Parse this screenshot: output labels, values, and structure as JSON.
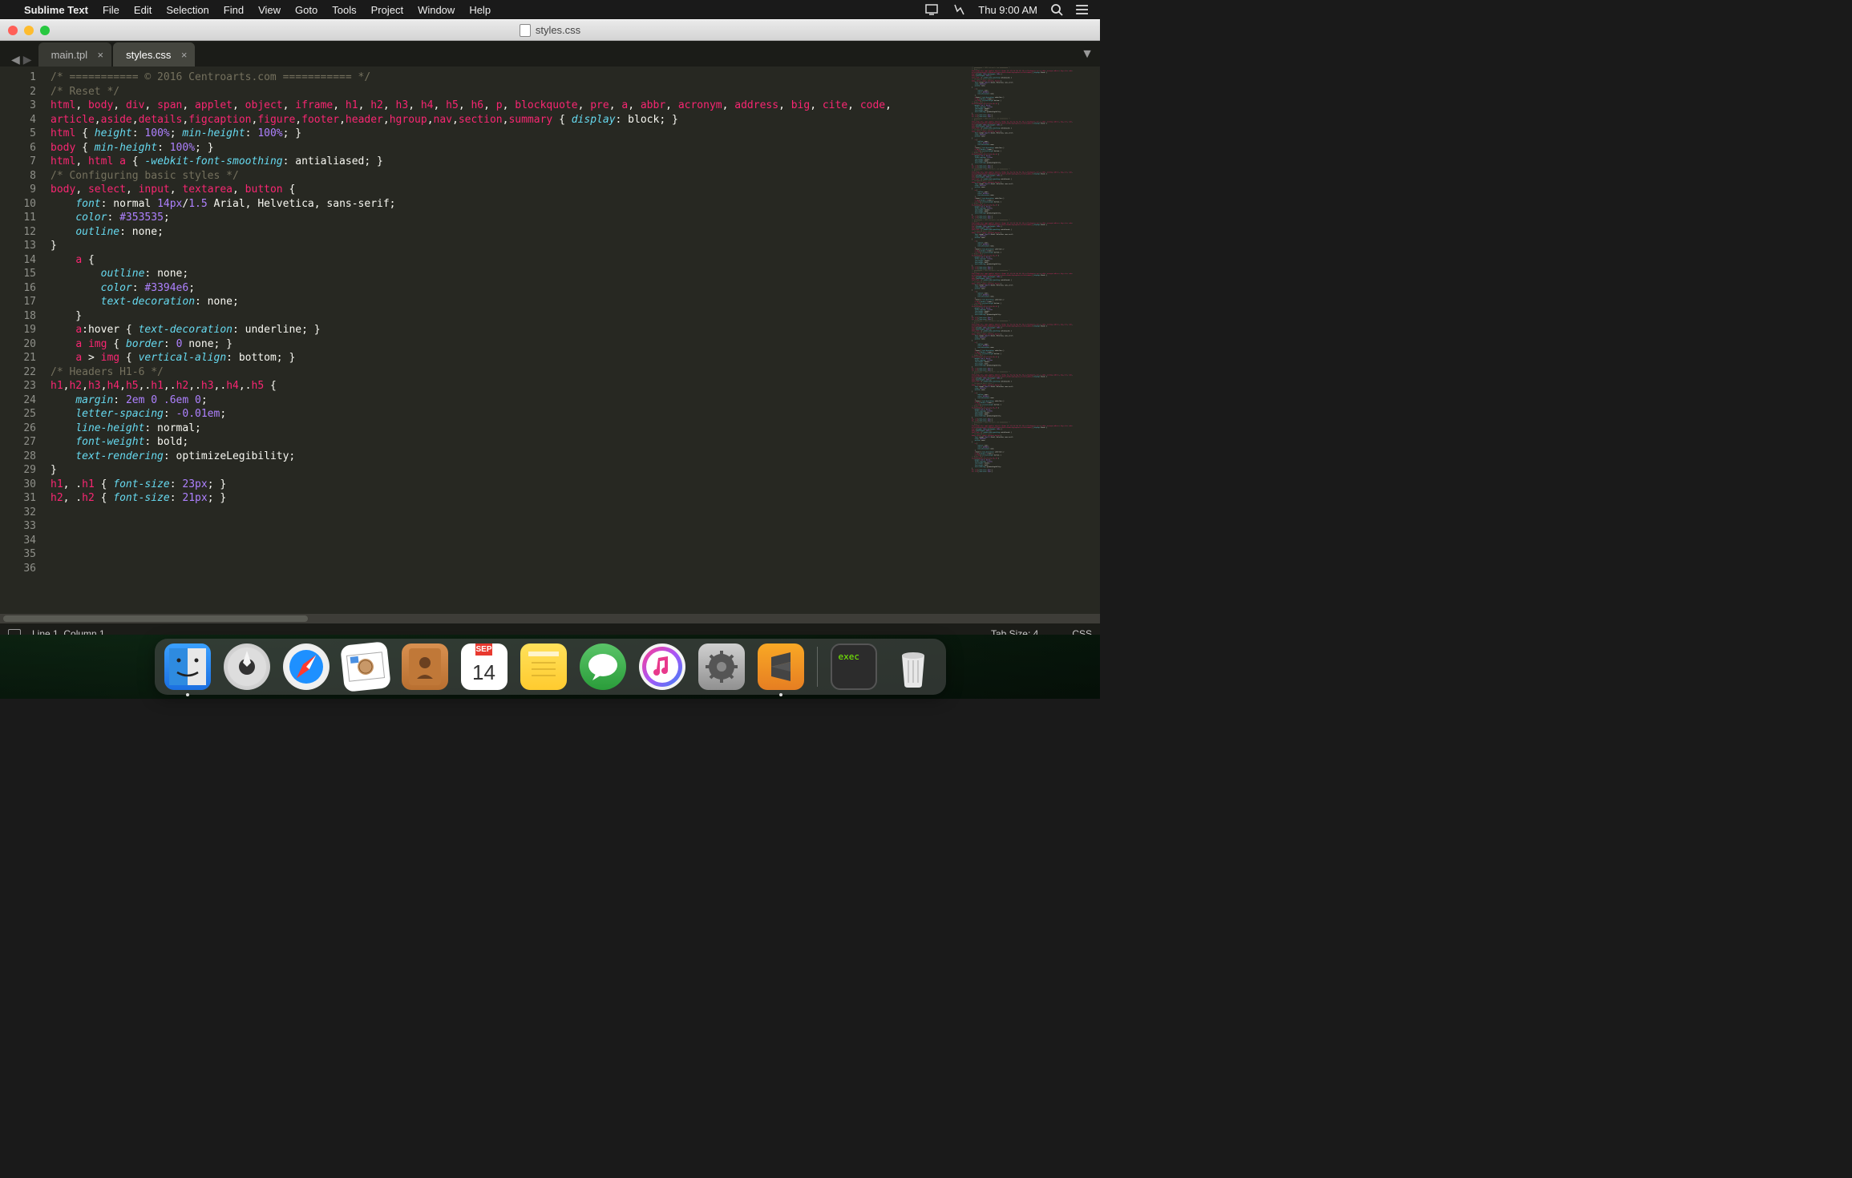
{
  "menubar": {
    "app": "Sublime Text",
    "items": [
      "File",
      "Edit",
      "Selection",
      "Find",
      "View",
      "Goto",
      "Tools",
      "Project",
      "Window",
      "Help"
    ],
    "clock": "Thu 9:00 AM"
  },
  "window": {
    "title": "styles.css"
  },
  "tabs": [
    {
      "label": "main.tpl",
      "active": false
    },
    {
      "label": "styles.css",
      "active": true
    }
  ],
  "status": {
    "position": "Line 1, Column 1",
    "tabsize": "Tab Size: 4",
    "syntax": "CSS"
  },
  "calendar": {
    "month": "SEP",
    "day": "14"
  },
  "code_lines": [
    [
      [
        "c-comment",
        "/* =========== © 2016 Centroarts.com =========== */"
      ]
    ],
    [
      [
        "",
        ""
      ]
    ],
    [
      [
        "c-comment",
        "/* Reset */"
      ]
    ],
    [
      [
        "c-tag",
        "html"
      ],
      [
        "c-punc",
        ", "
      ],
      [
        "c-tag",
        "body"
      ],
      [
        "c-punc",
        ", "
      ],
      [
        "c-tag",
        "div"
      ],
      [
        "c-punc",
        ", "
      ],
      [
        "c-tag",
        "span"
      ],
      [
        "c-punc",
        ", "
      ],
      [
        "c-tag",
        "applet"
      ],
      [
        "c-punc",
        ", "
      ],
      [
        "c-tag",
        "object"
      ],
      [
        "c-punc",
        ", "
      ],
      [
        "c-tag",
        "iframe"
      ],
      [
        "c-punc",
        ", "
      ],
      [
        "c-tag",
        "h1"
      ],
      [
        "c-punc",
        ", "
      ],
      [
        "c-tag",
        "h2"
      ],
      [
        "c-punc",
        ", "
      ],
      [
        "c-tag",
        "h3"
      ],
      [
        "c-punc",
        ", "
      ],
      [
        "c-tag",
        "h4"
      ],
      [
        "c-punc",
        ", "
      ],
      [
        "c-tag",
        "h5"
      ],
      [
        "c-punc",
        ", "
      ],
      [
        "c-tag",
        "h6"
      ],
      [
        "c-punc",
        ", "
      ],
      [
        "c-tag",
        "p"
      ],
      [
        "c-punc",
        ", "
      ],
      [
        "c-tag",
        "blockquote"
      ],
      [
        "c-punc",
        ", "
      ],
      [
        "c-tag",
        "pre"
      ],
      [
        "c-punc",
        ", "
      ],
      [
        "c-tag",
        "a"
      ],
      [
        "c-punc",
        ", "
      ],
      [
        "c-tag",
        "abbr"
      ],
      [
        "c-punc",
        ", "
      ],
      [
        "c-tag",
        "acronym"
      ],
      [
        "c-punc",
        ", "
      ],
      [
        "c-tag",
        "address"
      ],
      [
        "c-punc",
        ", "
      ],
      [
        "c-tag",
        "big"
      ],
      [
        "c-punc",
        ", "
      ],
      [
        "c-tag",
        "cite"
      ],
      [
        "c-punc",
        ", "
      ],
      [
        "c-tag",
        "code"
      ],
      [
        "c-punc",
        ", "
      ]
    ],
    [
      [
        "c-tag",
        "article"
      ],
      [
        "c-punc",
        ","
      ],
      [
        "c-tag",
        "aside"
      ],
      [
        "c-punc",
        ","
      ],
      [
        "c-tag",
        "details"
      ],
      [
        "c-punc",
        ","
      ],
      [
        "c-tag",
        "figcaption"
      ],
      [
        "c-punc",
        ","
      ],
      [
        "c-tag",
        "figure"
      ],
      [
        "c-punc",
        ","
      ],
      [
        "c-tag",
        "footer"
      ],
      [
        "c-punc",
        ","
      ],
      [
        "c-tag",
        "header"
      ],
      [
        "c-punc",
        ","
      ],
      [
        "c-tag",
        "hgroup"
      ],
      [
        "c-punc",
        ","
      ],
      [
        "c-tag",
        "nav"
      ],
      [
        "c-punc",
        ","
      ],
      [
        "c-tag",
        "section"
      ],
      [
        "c-punc",
        ","
      ],
      [
        "c-tag",
        "summary"
      ],
      [
        "c-white",
        " { "
      ],
      [
        "c-prop",
        "display"
      ],
      [
        "c-white",
        ": block; }"
      ]
    ],
    [
      [
        "",
        ""
      ]
    ],
    [
      [
        "c-tag",
        "html"
      ],
      [
        "c-white",
        " { "
      ],
      [
        "c-prop",
        "height"
      ],
      [
        "c-white",
        ": "
      ],
      [
        "c-num",
        "100%"
      ],
      [
        "c-white",
        "; "
      ],
      [
        "c-prop",
        "min-height"
      ],
      [
        "c-white",
        ": "
      ],
      [
        "c-num",
        "100%"
      ],
      [
        "c-white",
        "; }"
      ]
    ],
    [
      [
        "c-tag",
        "body"
      ],
      [
        "c-white",
        " { "
      ],
      [
        "c-prop",
        "min-height"
      ],
      [
        "c-white",
        ": "
      ],
      [
        "c-num",
        "100%"
      ],
      [
        "c-white",
        "; }"
      ]
    ],
    [
      [
        "c-tag",
        "html"
      ],
      [
        "c-punc",
        ", "
      ],
      [
        "c-tag",
        "html"
      ],
      [
        "c-white",
        " "
      ],
      [
        "c-tag",
        "a"
      ],
      [
        "c-white",
        " { "
      ],
      [
        "c-prop",
        "-webkit-font-smoothing"
      ],
      [
        "c-white",
        ": antialiased; }"
      ]
    ],
    [
      [
        "",
        ""
      ]
    ],
    [
      [
        "c-comment",
        "/* Configuring basic styles */"
      ]
    ],
    [
      [
        "c-tag",
        "body"
      ],
      [
        "c-punc",
        ", "
      ],
      [
        "c-tag",
        "select"
      ],
      [
        "c-punc",
        ", "
      ],
      [
        "c-tag",
        "input"
      ],
      [
        "c-punc",
        ", "
      ],
      [
        "c-tag",
        "textarea"
      ],
      [
        "c-punc",
        ", "
      ],
      [
        "c-tag",
        "button"
      ],
      [
        "c-white",
        " {"
      ]
    ],
    [
      [
        "c-white",
        "    "
      ],
      [
        "c-prop",
        "font"
      ],
      [
        "c-white",
        ": normal "
      ],
      [
        "c-num",
        "14px"
      ],
      [
        "c-white",
        "/"
      ],
      [
        "c-num",
        "1.5"
      ],
      [
        "c-white",
        " Arial, Helvetica, sans-serif;"
      ]
    ],
    [
      [
        "c-white",
        "    "
      ],
      [
        "c-prop",
        "color"
      ],
      [
        "c-white",
        ": "
      ],
      [
        "c-num",
        "#353535"
      ],
      [
        "c-white",
        ";"
      ]
    ],
    [
      [
        "c-white",
        "    "
      ],
      [
        "c-prop",
        "outline"
      ],
      [
        "c-white",
        ": none;"
      ]
    ],
    [
      [
        "c-white",
        "}"
      ]
    ],
    [
      [
        "c-white",
        "    "
      ],
      [
        "c-tag",
        "a"
      ],
      [
        "c-white",
        " {"
      ]
    ],
    [
      [
        "c-white",
        "        "
      ],
      [
        "c-prop",
        "outline"
      ],
      [
        "c-white",
        ": none;"
      ]
    ],
    [
      [
        "c-white",
        "        "
      ],
      [
        "c-prop",
        "color"
      ],
      [
        "c-white",
        ": "
      ],
      [
        "c-num",
        "#3394e6"
      ],
      [
        "c-white",
        ";"
      ]
    ],
    [
      [
        "c-white",
        "        "
      ],
      [
        "c-prop",
        "text-decoration"
      ],
      [
        "c-white",
        ": none;"
      ]
    ],
    [
      [
        "c-white",
        "    }"
      ]
    ],
    [
      [
        "c-white",
        "    "
      ],
      [
        "c-tag",
        "a"
      ],
      [
        "c-white",
        ":hover { "
      ],
      [
        "c-prop",
        "text-decoration"
      ],
      [
        "c-white",
        ": underline; }"
      ]
    ],
    [
      [
        "",
        ""
      ]
    ],
    [
      [
        "c-white",
        "    "
      ],
      [
        "c-tag",
        "a"
      ],
      [
        "c-white",
        " "
      ],
      [
        "c-tag",
        "img"
      ],
      [
        "c-white",
        " { "
      ],
      [
        "c-prop",
        "border"
      ],
      [
        "c-white",
        ": "
      ],
      [
        "c-num",
        "0"
      ],
      [
        "c-white",
        " none; }"
      ]
    ],
    [
      [
        "c-white",
        "    "
      ],
      [
        "c-tag",
        "a"
      ],
      [
        "c-white",
        " > "
      ],
      [
        "c-tag",
        "img"
      ],
      [
        "c-white",
        " { "
      ],
      [
        "c-prop",
        "vertical-align"
      ],
      [
        "c-white",
        ": bottom; }"
      ]
    ],
    [
      [
        "",
        ""
      ]
    ],
    [
      [
        "c-comment",
        "/* Headers H1-6 */"
      ]
    ],
    [
      [
        "c-tag",
        "h1"
      ],
      [
        "c-punc",
        ","
      ],
      [
        "c-tag",
        "h2"
      ],
      [
        "c-punc",
        ","
      ],
      [
        "c-tag",
        "h3"
      ],
      [
        "c-punc",
        ","
      ],
      [
        "c-tag",
        "h4"
      ],
      [
        "c-punc",
        ","
      ],
      [
        "c-tag",
        "h5"
      ],
      [
        "c-punc",
        ",."
      ],
      [
        "c-tag",
        "h1"
      ],
      [
        "c-punc",
        ",."
      ],
      [
        "c-tag",
        "h2"
      ],
      [
        "c-punc",
        ",."
      ],
      [
        "c-tag",
        "h3"
      ],
      [
        "c-punc",
        ",."
      ],
      [
        "c-tag",
        "h4"
      ],
      [
        "c-punc",
        ",."
      ],
      [
        "c-tag",
        "h5"
      ],
      [
        "c-white",
        " {"
      ]
    ],
    [
      [
        "c-white",
        "    "
      ],
      [
        "c-prop",
        "margin"
      ],
      [
        "c-white",
        ": "
      ],
      [
        "c-num",
        "2em"
      ],
      [
        "c-white",
        " "
      ],
      [
        "c-num",
        "0"
      ],
      [
        "c-white",
        " "
      ],
      [
        "c-num",
        ".6em"
      ],
      [
        "c-white",
        " "
      ],
      [
        "c-num",
        "0"
      ],
      [
        "c-white",
        ";"
      ]
    ],
    [
      [
        "c-white",
        "    "
      ],
      [
        "c-prop",
        "letter-spacing"
      ],
      [
        "c-white",
        ": "
      ],
      [
        "c-num",
        "-0.01em"
      ],
      [
        "c-white",
        ";"
      ]
    ],
    [
      [
        "c-white",
        "    "
      ],
      [
        "c-prop",
        "line-height"
      ],
      [
        "c-white",
        ": normal;"
      ]
    ],
    [
      [
        "c-white",
        "    "
      ],
      [
        "c-prop",
        "font-weight"
      ],
      [
        "c-white",
        ": bold;"
      ]
    ],
    [
      [
        "c-white",
        "    "
      ],
      [
        "c-prop",
        "text-rendering"
      ],
      [
        "c-white",
        ": optimizeLegibility;"
      ]
    ],
    [
      [
        "c-white",
        "}"
      ]
    ],
    [
      [
        "c-tag",
        "h1"
      ],
      [
        "c-punc",
        ", ."
      ],
      [
        "c-tag",
        "h1"
      ],
      [
        "c-white",
        " { "
      ],
      [
        "c-prop",
        "font-size"
      ],
      [
        "c-white",
        ": "
      ],
      [
        "c-num",
        "23px"
      ],
      [
        "c-white",
        "; }"
      ]
    ],
    [
      [
        "c-tag",
        "h2"
      ],
      [
        "c-punc",
        ", ."
      ],
      [
        "c-tag",
        "h2"
      ],
      [
        "c-white",
        " { "
      ],
      [
        "c-prop",
        "font-size"
      ],
      [
        "c-white",
        ": "
      ],
      [
        "c-num",
        "21px"
      ],
      [
        "c-white",
        "; }"
      ]
    ]
  ]
}
